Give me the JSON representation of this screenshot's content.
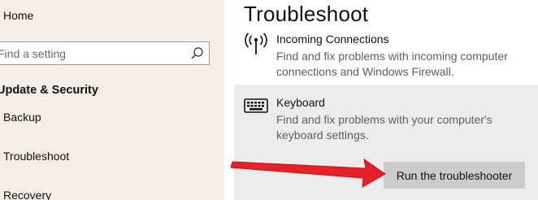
{
  "sidebar": {
    "home_label": "Home",
    "search_placeholder": "Find a setting",
    "section_title": "Update & Security",
    "items": [
      {
        "label": "Backup"
      },
      {
        "label": "Troubleshoot"
      },
      {
        "label": "Recovery"
      }
    ]
  },
  "main": {
    "title": "Troubleshoot",
    "incoming": {
      "title": "Incoming Connections",
      "description": "Find and fix problems with incoming computer connections and Windows Firewall."
    },
    "keyboard": {
      "title": "Keyboard",
      "description": "Find and fix problems with your computer's keyboard settings."
    },
    "run_button": "Run the troubleshooter"
  },
  "icons": {
    "search": "search-icon",
    "incoming": "antenna-icon",
    "keyboard": "keyboard-icon"
  },
  "colors": {
    "sidebar_bg": "#f6eee6",
    "panel_bg": "#ececec",
    "button_bg": "#cccccc",
    "arrow": "#e8202a"
  }
}
